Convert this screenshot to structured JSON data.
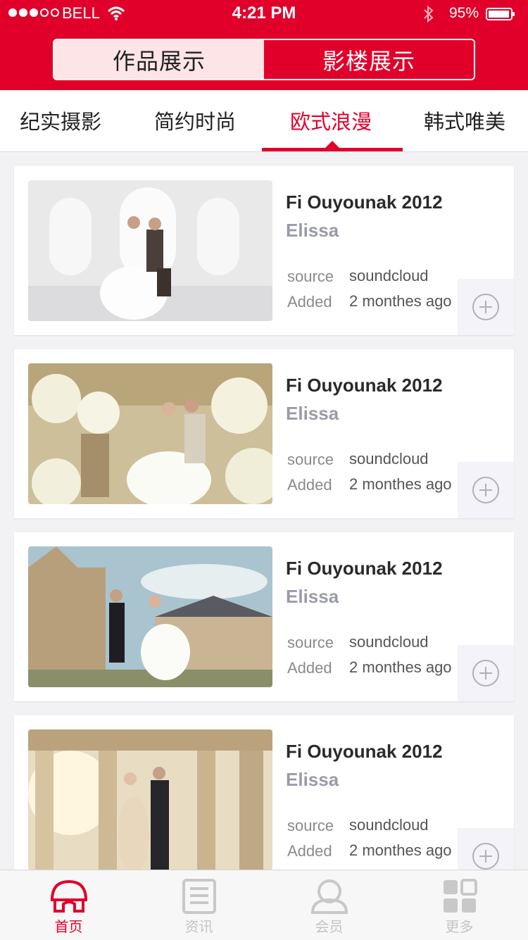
{
  "status_bar": {
    "carrier": "BELL",
    "time": "4:21 PM",
    "battery": "95%",
    "battery_level": 0.95,
    "signal_bars_filled": 3,
    "signal_bars_total": 5
  },
  "segment": {
    "items": [
      "作品展示",
      "影楼展示"
    ],
    "selected_index": 0
  },
  "category_tabs": {
    "items": [
      "纪实摄影",
      "简约时尚",
      "欧式浪漫",
      "韩式唯美"
    ],
    "selected_index": 2
  },
  "cards": [
    {
      "title": "Fi Ouyounak 2012",
      "subtitle": "Elissa",
      "source_label": "source",
      "source_value": "soundcloud",
      "added_label": "Added",
      "added_value": "2 monthes ago",
      "image": "wedding-photo-white-church-interior"
    },
    {
      "title": "Fi Ouyounak 2012",
      "subtitle": "Elissa",
      "source_label": "source",
      "source_value": "soundcloud",
      "added_label": "Added",
      "added_value": "2 monthes ago",
      "image": "wedding-photo-couple-among-white-flowers"
    },
    {
      "title": "Fi Ouyounak 2012",
      "subtitle": "Elissa",
      "source_label": "source",
      "source_value": "soundcloud",
      "added_label": "Added",
      "added_value": "2 monthes ago",
      "image": "wedding-photo-european-castle-outdoor"
    },
    {
      "title": "Fi Ouyounak 2012",
      "subtitle": "Elissa",
      "source_label": "source",
      "source_value": "soundcloud",
      "added_label": "Added",
      "added_value": "2 monthes ago",
      "image": "wedding-photo-colonnade-sunlight"
    }
  ],
  "tab_bar": {
    "items": [
      {
        "label": "首页",
        "icon": "home-icon",
        "active": true
      },
      {
        "label": "资讯",
        "icon": "news-list-icon",
        "active": false
      },
      {
        "label": "会员",
        "icon": "member-icon",
        "active": false
      },
      {
        "label": "更多",
        "icon": "more-grid-icon",
        "active": false
      }
    ]
  },
  "colors": {
    "accent": "#e1002a",
    "segment_active_bg": "#fde4e7",
    "subtitle": "#9a9ba8",
    "background": "#f2f2f4"
  }
}
